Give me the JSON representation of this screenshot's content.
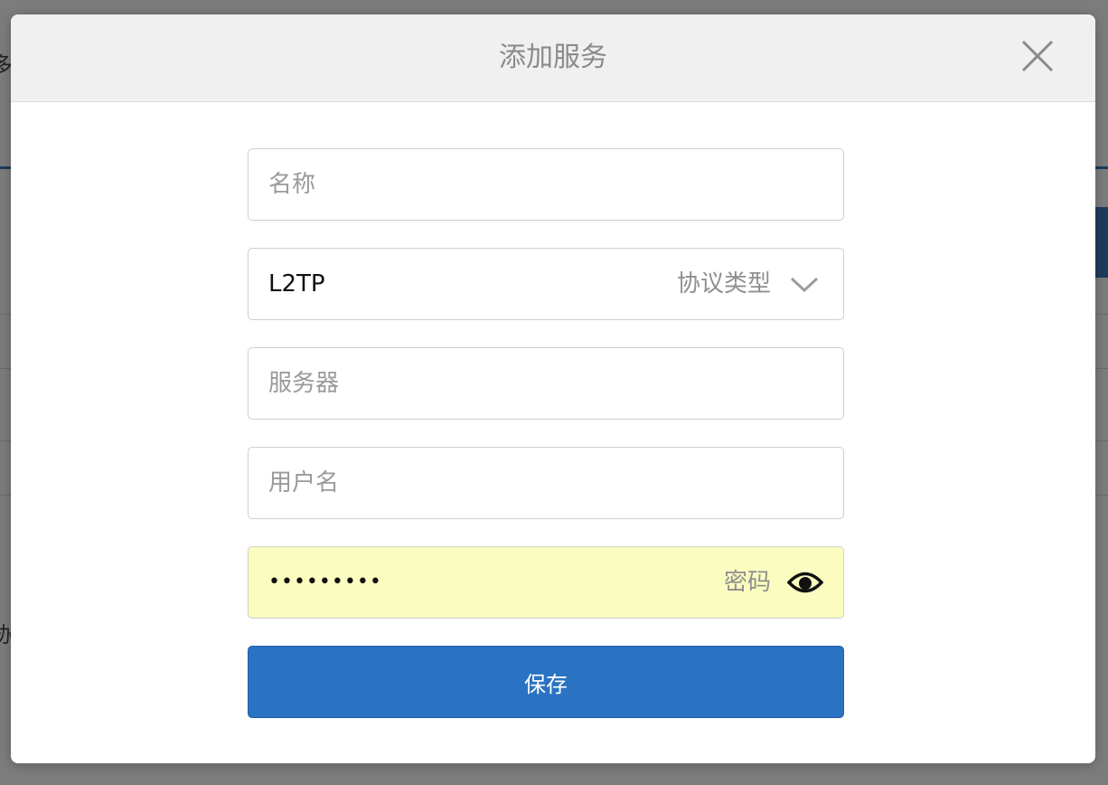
{
  "background": {
    "fragment_top": "多",
    "fragment_bottom": "协"
  },
  "modal": {
    "title": "添加服务",
    "close_icon": "close-icon"
  },
  "form": {
    "name": {
      "placeholder": "名称",
      "value": ""
    },
    "protocol": {
      "value": "L2TP",
      "label": "协议类型",
      "icon": "chevron-down-icon"
    },
    "server": {
      "placeholder": "服务器",
      "value": ""
    },
    "username": {
      "placeholder": "用户名",
      "value": ""
    },
    "password": {
      "masked_value": "•••••••••",
      "label": "密码",
      "icon": "eye-icon"
    },
    "save_label": "保存"
  },
  "colors": {
    "primary": "#2a73c2",
    "autofill": "#fafcc0",
    "header_bg": "#f0f0f0"
  }
}
